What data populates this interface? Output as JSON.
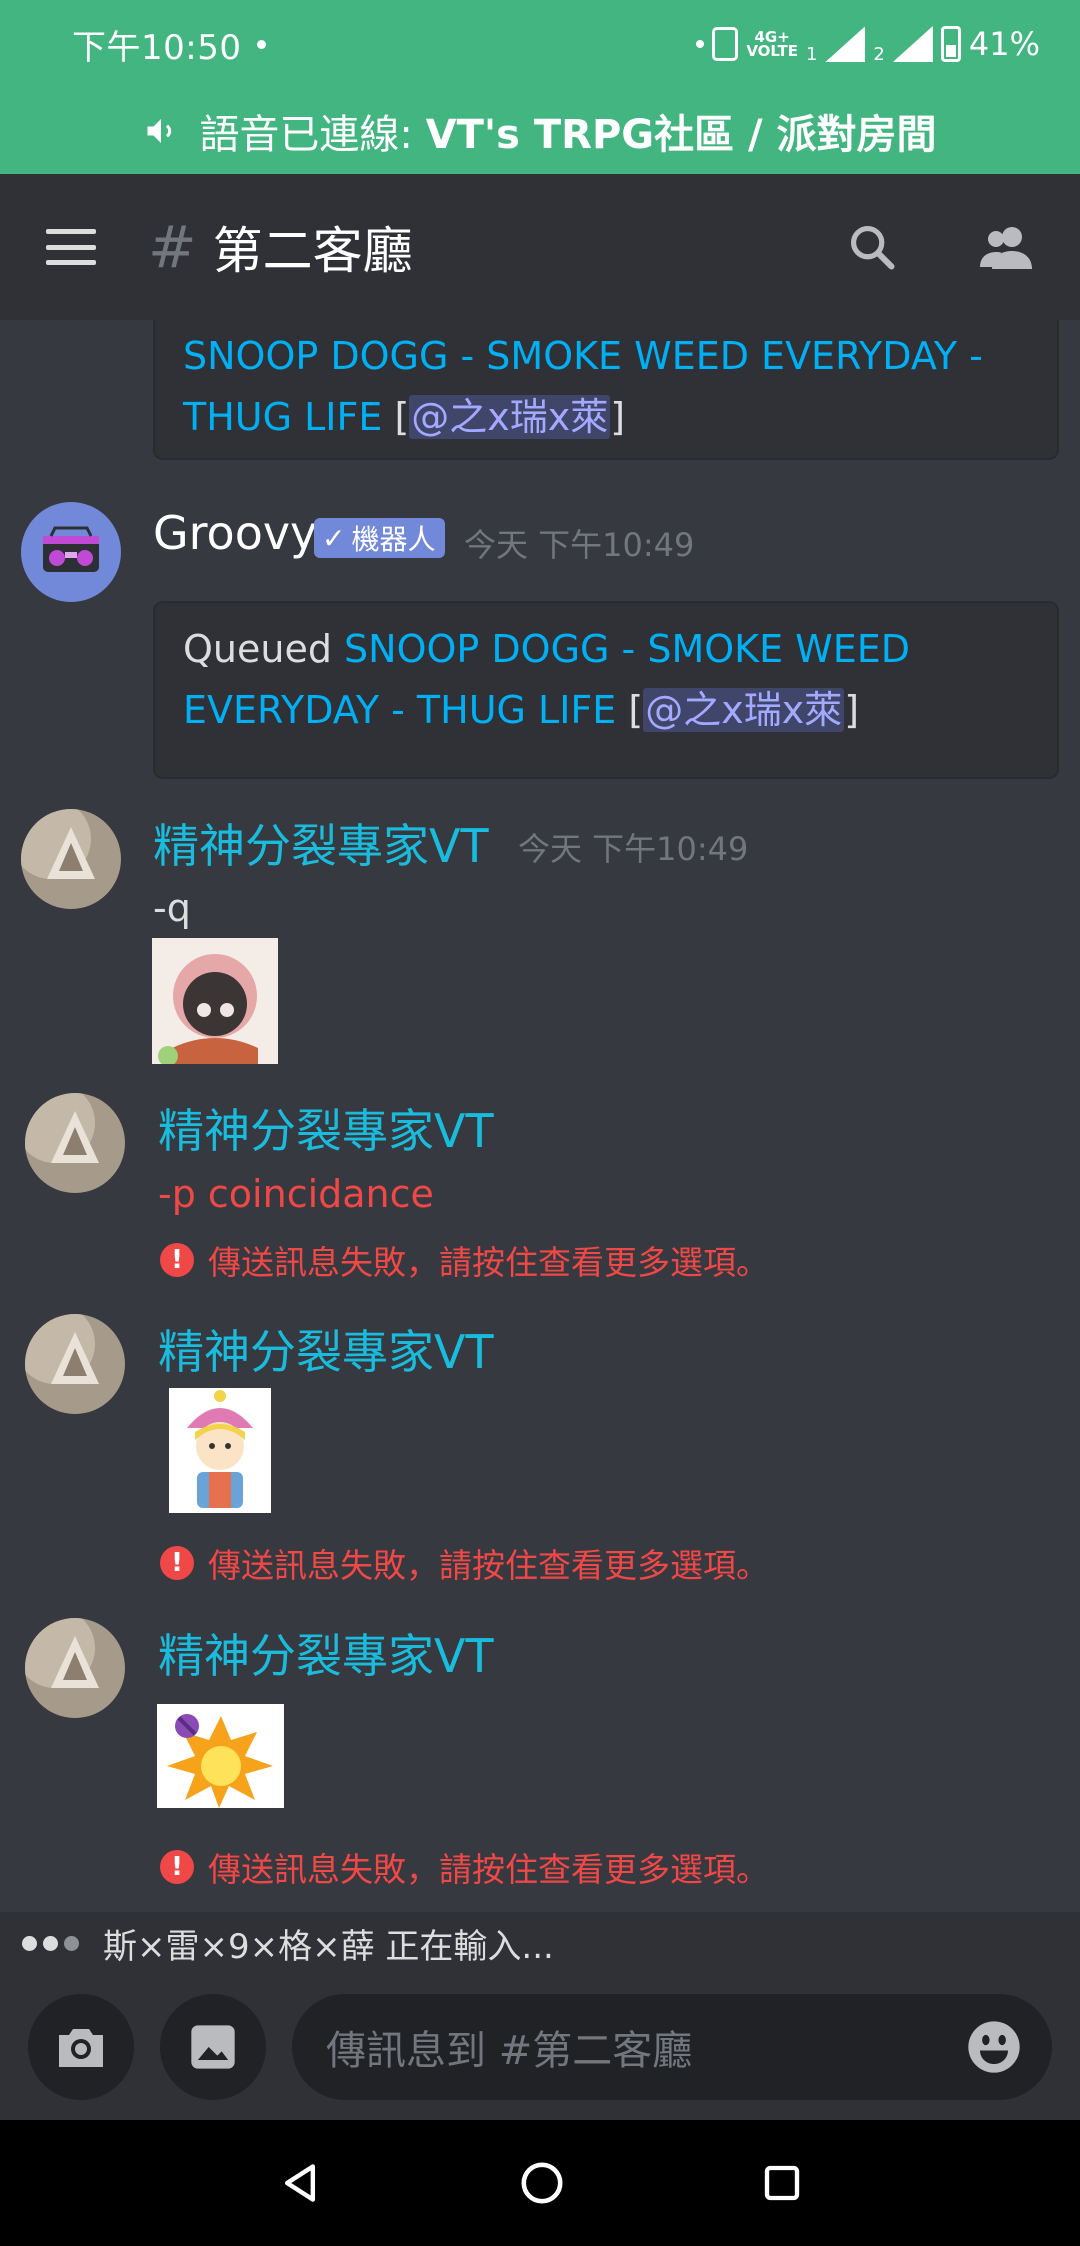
{
  "status_bar": {
    "time": "下午10:50",
    "network": "4G+",
    "volte": "VOLTE",
    "sim1": "1",
    "sim2": "2",
    "battery": "41%"
  },
  "voice_banner": {
    "prefix": "語音已連線: ",
    "location": "VT's TRPG社區 / 派對房間"
  },
  "header": {
    "hash": "#",
    "channel_name": "第二客廳"
  },
  "messages": {
    "m0": {
      "link_line1": "SNOOP DOGG - SMOKE WEED EVERYDAY -",
      "link_line2": "THUG LIFE",
      "open_bracket": " [",
      "mention": "@之x瑞x萊",
      "close_bracket": "]"
    },
    "m1": {
      "username": "Groovy",
      "badge": "機器人",
      "timestamp": "今天 下午10:49",
      "queued": "Queued ",
      "link_line1": "SNOOP DOGG - SMOKE WEED",
      "link_line2": "EVERYDAY - THUG LIFE",
      "open_bracket": " [",
      "mention": "@之x瑞x萊",
      "close_bracket": "]"
    },
    "m2": {
      "username": "精神分裂專家VT",
      "timestamp": "今天 下午10:49",
      "text": "-q"
    },
    "m3": {
      "username": "精神分裂專家VT",
      "text": "-p coincidance",
      "error": "傳送訊息失敗，請按住查看更多選項。"
    },
    "m4": {
      "username": "精神分裂專家VT",
      "error": "傳送訊息失敗，請按住查看更多選項。"
    },
    "m5": {
      "username": "精神分裂專家VT",
      "error": "傳送訊息失敗，請按住查看更多選項。"
    }
  },
  "typing": {
    "text": "斯×雷×9×格×薛 正在輸入..."
  },
  "composer": {
    "placeholder": "傳訊息到 #第二客廳"
  },
  "colors": {
    "brand_green": "#43b581",
    "bg": "#36393f",
    "link": "#00b0f4",
    "vt_user": "#1abcde",
    "error": "#f04747",
    "badge": "#7289da"
  }
}
